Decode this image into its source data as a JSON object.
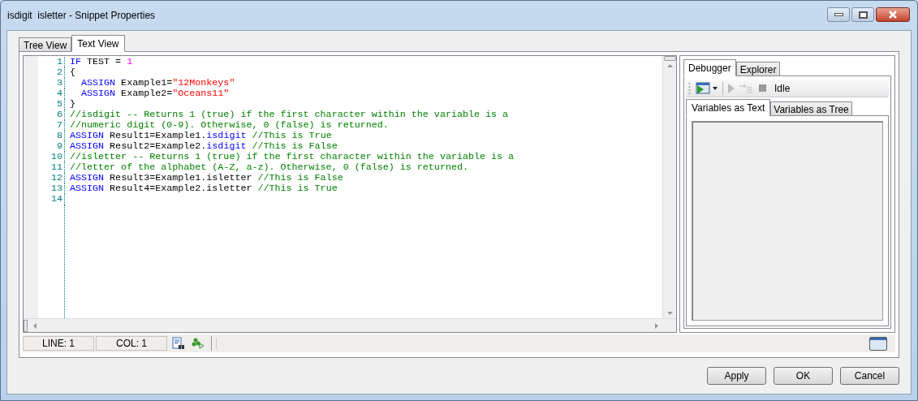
{
  "window": {
    "title": "isdigit  isletter - Snippet Properties"
  },
  "tabs": [
    {
      "label": "Tree View",
      "selected": false
    },
    {
      "label": "Text View",
      "selected": true
    }
  ],
  "editor": {
    "lines": [
      {
        "number": "1",
        "tokens": [
          {
            "kind": "keyword",
            "text": "IF"
          },
          {
            "kind": "plain",
            "text": " TEST = "
          },
          {
            "kind": "number",
            "text": "1"
          }
        ]
      },
      {
        "number": "2",
        "tokens": [
          {
            "kind": "plain",
            "text": "{"
          }
        ]
      },
      {
        "number": "3",
        "tokens": [
          {
            "kind": "keyword",
            "text": "  ASSIGN"
          },
          {
            "kind": "plain",
            "text": " Example1="
          },
          {
            "kind": "string",
            "text": "\"12Monkeys\""
          }
        ]
      },
      {
        "number": "4",
        "tokens": [
          {
            "kind": "keyword",
            "text": "  ASSIGN"
          },
          {
            "kind": "plain",
            "text": " Example2="
          },
          {
            "kind": "string",
            "text": "\"Oceans11\""
          }
        ]
      },
      {
        "number": "5",
        "tokens": [
          {
            "kind": "plain",
            "text": "}"
          }
        ]
      },
      {
        "number": "6",
        "tokens": [
          {
            "kind": "comment",
            "text": "//isdigit -- Returns 1 (true) if the first character within the variable is a"
          }
        ]
      },
      {
        "number": "7",
        "tokens": [
          {
            "kind": "comment",
            "text": "//numeric digit (0-9). Otherwise, 0 (false) is returned."
          }
        ]
      },
      {
        "number": "8",
        "tokens": [
          {
            "kind": "keyword",
            "text": "ASSIGN"
          },
          {
            "kind": "plain",
            "text": " Result1=Example1."
          },
          {
            "kind": "keyword",
            "text": "isdigit"
          },
          {
            "kind": "comment",
            "text": " //This is True"
          }
        ]
      },
      {
        "number": "9",
        "tokens": [
          {
            "kind": "keyword",
            "text": "ASSIGN"
          },
          {
            "kind": "plain",
            "text": " Result2=Example2."
          },
          {
            "kind": "keyword",
            "text": "isdigit"
          },
          {
            "kind": "comment",
            "text": " //This is False"
          }
        ]
      },
      {
        "number": "10",
        "tokens": [
          {
            "kind": "comment",
            "text": "//isletter -- Returns 1 (true) if the first character within the variable is a"
          }
        ]
      },
      {
        "number": "11",
        "tokens": [
          {
            "kind": "comment",
            "text": "//letter of the alphabet (A-Z, a-z). Otherwise, 0 (false) is returned."
          }
        ]
      },
      {
        "number": "12",
        "tokens": [
          {
            "kind": "keyword",
            "text": "ASSIGN"
          },
          {
            "kind": "plain",
            "text": " Result3=Example1.isletter "
          },
          {
            "kind": "comment",
            "text": "//This is False"
          }
        ]
      },
      {
        "number": "13",
        "tokens": [
          {
            "kind": "keyword",
            "text": "ASSIGN"
          },
          {
            "kind": "plain",
            "text": " Result4=Example2.isletter "
          },
          {
            "kind": "comment",
            "text": "//This is True"
          }
        ]
      },
      {
        "number": "14"
      }
    ]
  },
  "status_bar": {
    "line": "LINE: 1",
    "col": "COL: 1"
  },
  "side_panel": {
    "tabs": [
      {
        "label": "Debugger",
        "selected": true
      },
      {
        "label": "Explorer",
        "selected": false
      }
    ],
    "toolbar": {
      "state": "Idle"
    },
    "inner_tabs": [
      {
        "label": "Variables as Text",
        "selected": true
      },
      {
        "label": "Variables as Tree",
        "selected": false
      }
    ]
  },
  "buttons": [
    "Apply",
    "OK",
    "Cancel"
  ]
}
